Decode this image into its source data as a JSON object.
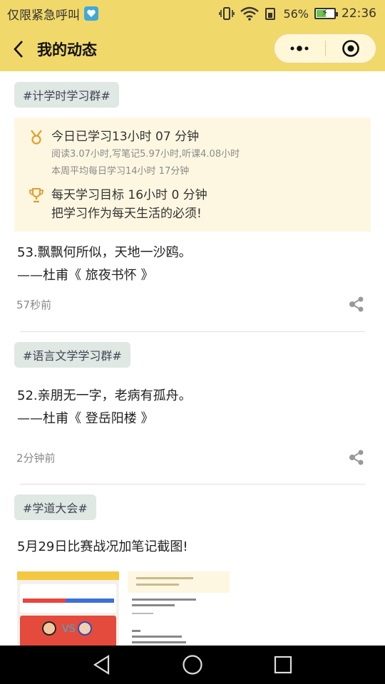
{
  "status_bar": {
    "carrier": "仅限紧急呼叫",
    "battery_percent": "56%",
    "battery_level": 0.56,
    "time": "22:36"
  },
  "header": {
    "title": "我的动态"
  },
  "posts": [
    {
      "tag": "#计学时学习群#",
      "card": {
        "today_study": "今日已学习13小时 07 分钟",
        "breakdown": "阅读3.07小时,写笔记5.97小时,听课4.08小时",
        "week_avg": "本周平均每日学习14小时 17分钟",
        "goal": "每天学习目标 16小时 0 分钟",
        "motto": "把学习作为每天生活的必须!"
      },
      "text_line1": "53.飘飘何所似，天地一沙鸥。",
      "text_line2": "——杜甫《 旅夜书怀 》",
      "time": "57秒前"
    },
    {
      "tag": "#语言文学学习群#",
      "text_line1": "52.亲朋无一字，老病有孤舟。",
      "text_line2": "——杜甫《 登岳阳楼 》",
      "time": "2分钟前"
    },
    {
      "tag": "#学道大会#",
      "text_line1": "5月29日比赛战况加笔记截图!"
    }
  ],
  "colors": {
    "header_bg": "#f1d86a",
    "tag_bg": "#dfe8e3",
    "card_bg": "#fdf7e1",
    "accent_orange": "#e79b2a"
  }
}
